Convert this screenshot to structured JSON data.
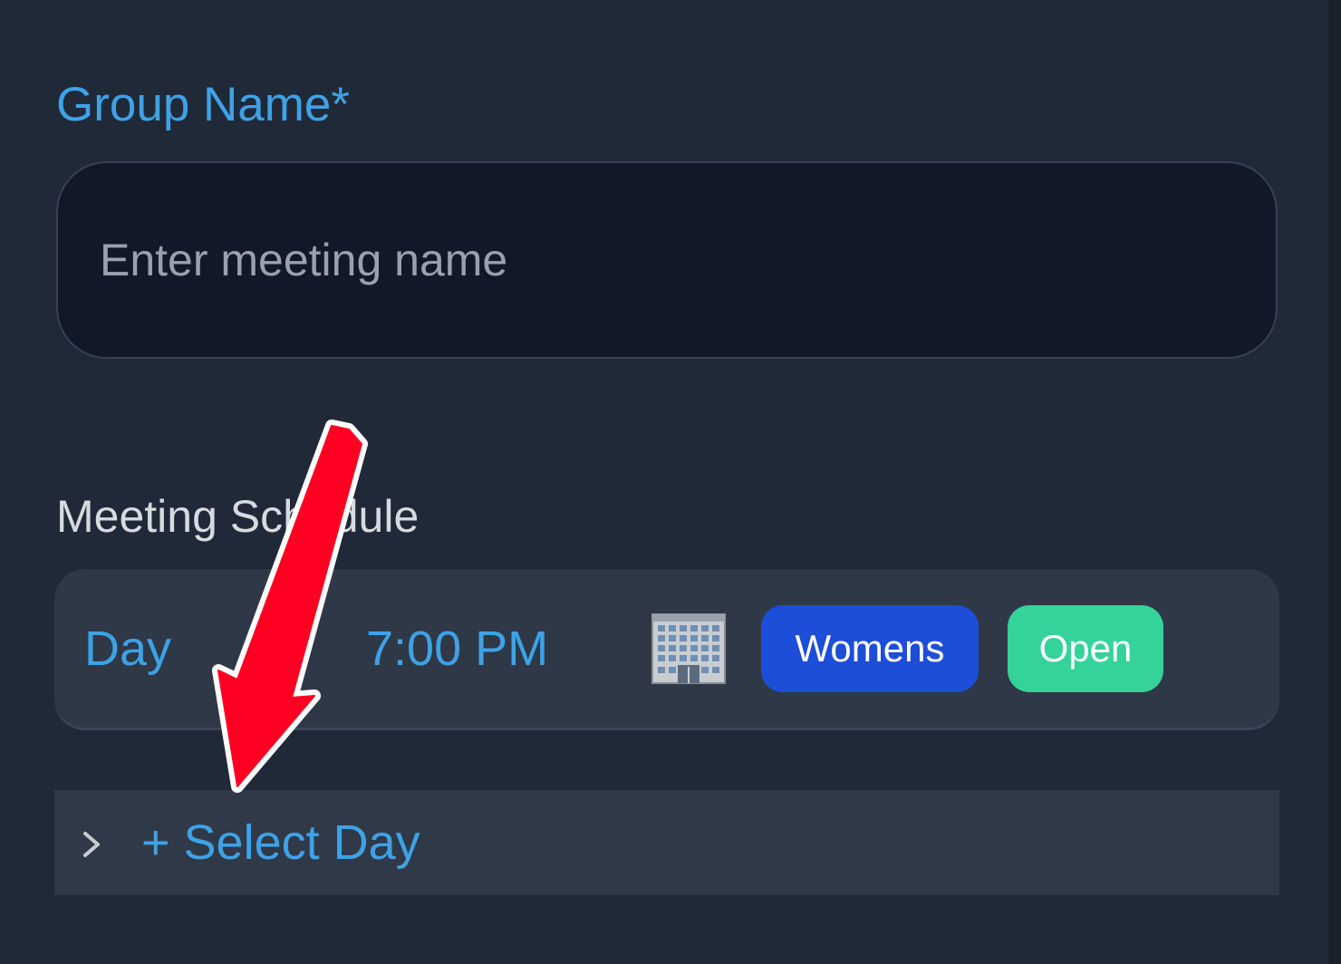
{
  "form": {
    "group_name_label": "Group Name*",
    "group_name_placeholder": "Enter meeting name",
    "group_name_value": ""
  },
  "schedule": {
    "section_title": "Meeting Schedule",
    "entries": [
      {
        "day": "Day",
        "time": "7:00 PM",
        "location_icon": "building-icon",
        "tags": [
          {
            "label": "Womens",
            "color": "#1d4ed8"
          },
          {
            "label": "Open",
            "color": "#34d399"
          }
        ]
      }
    ],
    "add_day_label": "+ Select Day",
    "add_day_icon": "chevron-right-icon"
  },
  "annotation": {
    "arrow_color": "#ff0022",
    "arrow_outline": "#ffffff",
    "arrow_icon": "red-arrow-icon"
  },
  "colors": {
    "background": "#202938",
    "accent": "#3ea2e6",
    "input_background": "#111827",
    "card_background": "#2f3846"
  }
}
